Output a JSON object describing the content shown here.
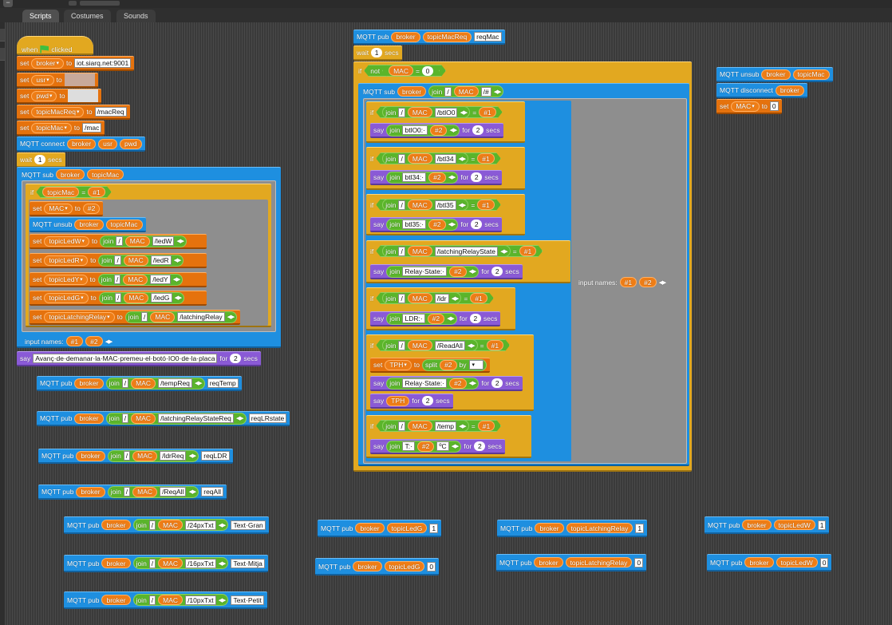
{
  "tabs": {
    "scripts": "Scripts",
    "costumes": "Costumes",
    "sounds": "Sounds"
  },
  "blocks": {
    "when": "when",
    "clicked": "clicked",
    "set": "set",
    "to": "to",
    "mqtt_connect": "MQTT connect",
    "wait": "wait",
    "secs": "secs",
    "mqtt_sub": "MQTT sub",
    "mqtt_unsub": "MQTT unsub",
    "mqtt_pub": "MQTT pub",
    "mqtt_disconnect": "MQTT disconnect",
    "if": "if",
    "not": "not",
    "join": "join",
    "say": "say",
    "for": "for",
    "split": "split",
    "by": "by",
    "input_names": "input names:",
    "eq": "="
  },
  "vars": {
    "broker": "broker",
    "usr": "usr",
    "pwd": "pwd",
    "topicMacReq": "topicMacReq",
    "topicMac": "topicMac",
    "MAC": "MAC",
    "topicLedW": "topicLedW",
    "topicLedR": "topicLedR",
    "topicLedY": "topicLedY",
    "topicLedG": "topicLedG",
    "topicLatchingRelay": "topicLatchingRelay",
    "TPH": "TPH",
    "p1": "#1",
    "p2": "#2"
  },
  "values": {
    "broker_url": "iot.siarq.net:9001",
    "macreq": "/macReq",
    "mac": "/mac",
    "slash": "/",
    "ledW": "/ledW",
    "ledR": "/ledR",
    "ledY": "/ledY",
    "ledG": "/ledG",
    "latchingRelay": "/latchingRelay",
    "one": "1",
    "zero": "0",
    "two": "2",
    "say_text": "Avanç·de·demanar·la·MAC·premeu·el·botó·IO0·de·la·placa",
    "tempReq": "/tempReq",
    "reqTemp": "reqTemp",
    "lrsReq": "/latchingRelayStateReq",
    "reqLRstate": "reqLRstate",
    "ldrReq": "/ldrReq",
    "reqLDR": "reqLDR",
    "reqAllT": "/ReqAll",
    "reqAll": "reqAll",
    "px24": "/24pxTxt",
    "tgran": "Text·Gran",
    "px16": "/16pxTxt",
    "tmitja": "Text·Mitja",
    "px10": "/10pxTxt",
    "tpetit": "Text·Petit",
    "reqMac": "reqMac",
    "hash": "/#",
    "btl00": "/btlO0",
    "btl00say": "btlO0:·",
    "btl34": "/btl34",
    "btl34say": "btl34:·",
    "btl35": "/btl35",
    "btl35say": "btl35:·",
    "lrs": "/latchingRelayState",
    "relaySay": "Relay·State:·",
    "ldr": "/ldr",
    "ldrSay": "LDR:·",
    "readAll": "/ReadAll",
    "temp": "/temp",
    "tSay": "T:·",
    "degC": "ºC",
    "space": " "
  }
}
